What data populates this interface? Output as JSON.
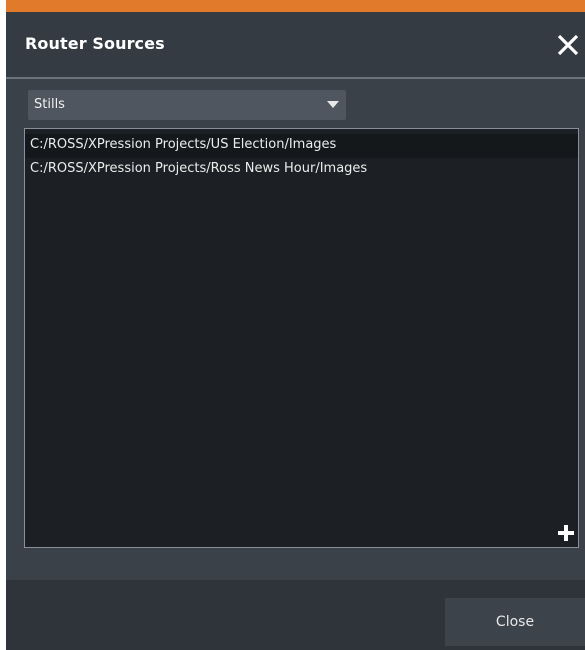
{
  "dialog": {
    "title": "Router Sources",
    "accent_color": "#e17a2b",
    "close_icon": "close-icon"
  },
  "source_type": {
    "selected": "Stills"
  },
  "sources": {
    "items": [
      "C:/ROSS/XPression Projects/US Election/Images",
      "C:/ROSS/XPression Projects/Ross News Hour/Images"
    ],
    "add_icon": "plus-icon"
  },
  "footer": {
    "close_label": "Close"
  }
}
